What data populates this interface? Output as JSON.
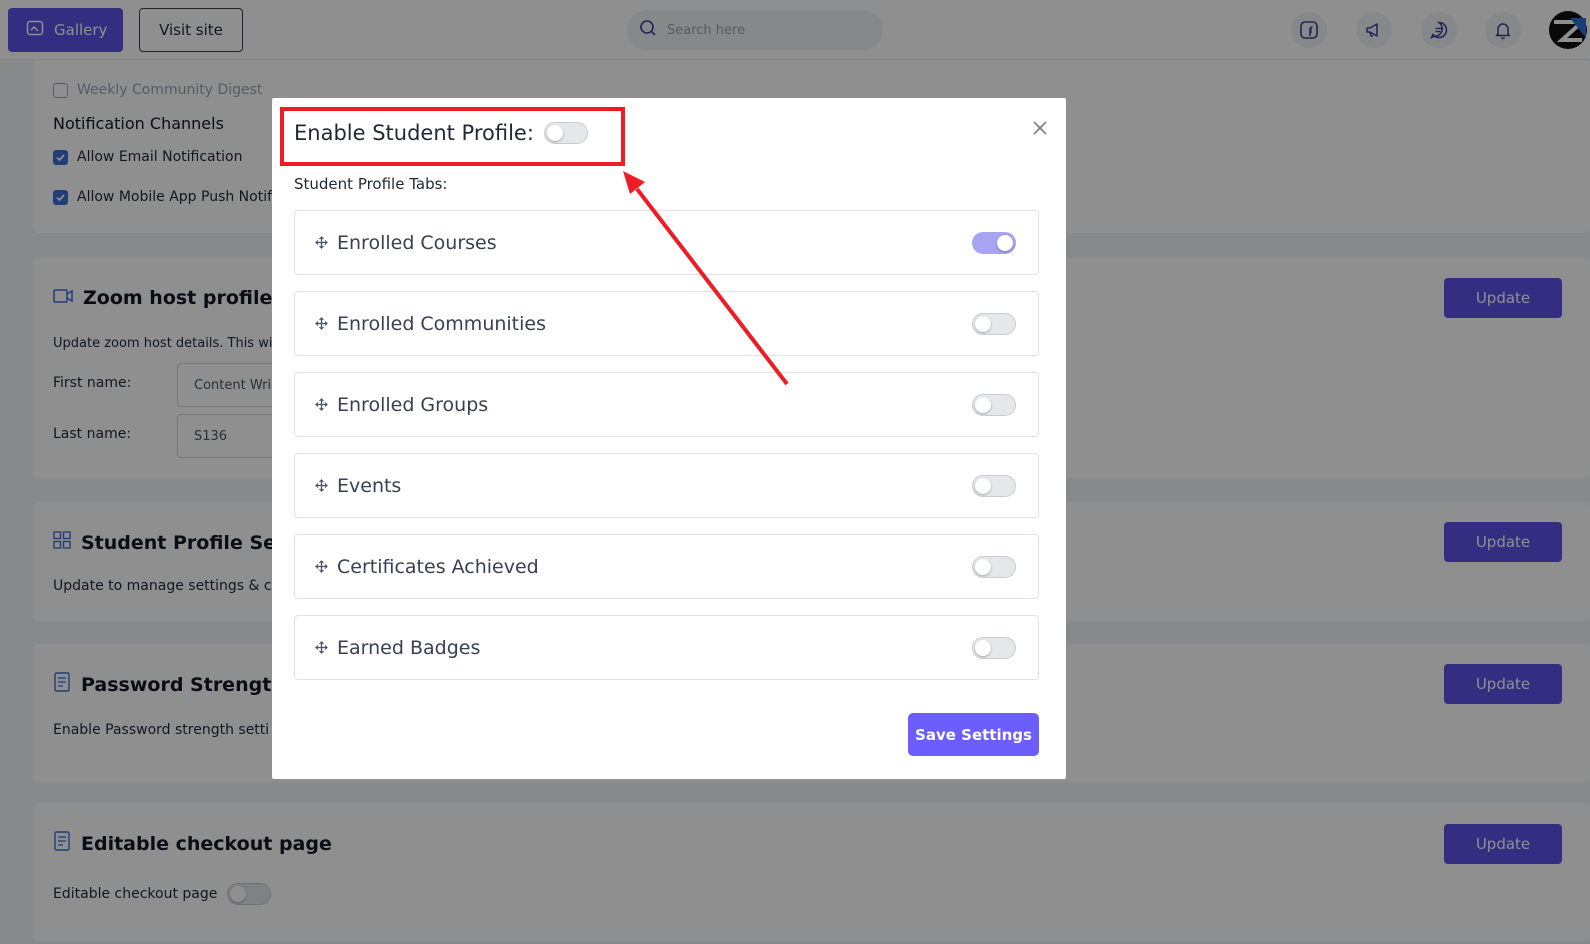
{
  "topbar": {
    "gallery_label": "Gallery",
    "visit_label": "Visit site",
    "search_placeholder": "Search here"
  },
  "background": {
    "weekly_digest": "Weekly Community Digest",
    "notification_channels": "Notification Channels",
    "email_notification": "Allow Email Notification",
    "push_notification": "Allow Mobile App Push Notifi",
    "zoom_title": "Zoom host profile se",
    "zoom_desc": "Update zoom host details. This will",
    "first_name_label": "First name",
    "first_name_value": "Content Wri",
    "last_name_label": "Last name",
    "last_name_value": "S136",
    "student_title": "Student Profile Setti",
    "student_desc": "Update to manage settings & c",
    "password_title": "Password Strength",
    "password_desc": "Enable Password strength setti",
    "checkout_title": "Editable checkout page",
    "checkout_desc": "Editable checkout page",
    "update_label": "Update",
    "label_colon": ":"
  },
  "modal": {
    "title": "Enable Student Profile:",
    "enabled": false,
    "tabs_label": "Student Profile Tabs:",
    "tabs": [
      {
        "label": "Enrolled Courses",
        "enabled": true
      },
      {
        "label": "Enrolled Communities",
        "enabled": false
      },
      {
        "label": "Enrolled Groups",
        "enabled": false
      },
      {
        "label": "Events",
        "enabled": false
      },
      {
        "label": "Certificates Achieved",
        "enabled": false
      },
      {
        "label": "Earned Badges",
        "enabled": false
      }
    ],
    "save_label": "Save Settings"
  },
  "colors": {
    "primary": "#5b52e8",
    "save_button": "#6c5dff",
    "annotation": "#ee1c24"
  }
}
